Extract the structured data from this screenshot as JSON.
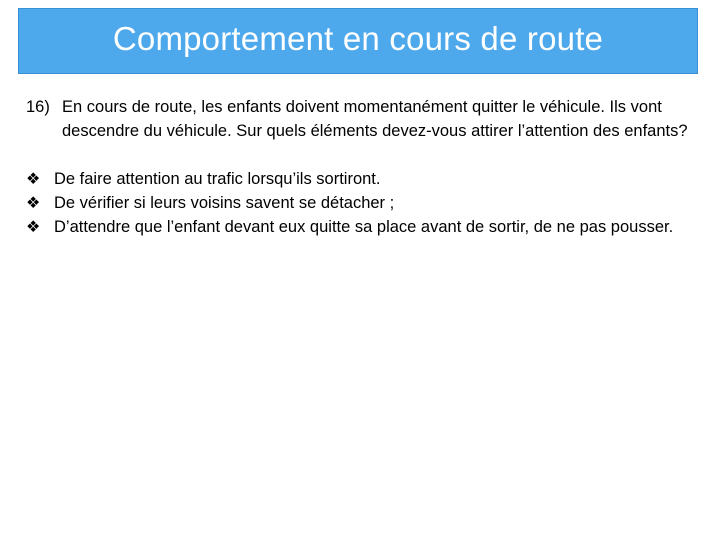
{
  "slide": {
    "title": "Comportement en cours de route",
    "accent_color": "#4ea8ec"
  },
  "question": {
    "number": "16)",
    "text": "En cours de route, les enfants doivent momentanément quitter le véhicule. Ils vont descendre du véhicule. Sur quels éléments devez-vous attirer l’attention des enfants?"
  },
  "bullets": {
    "icon": "diamond-bullet-icon",
    "items": [
      {
        "text": "De faire attention au trafic lorsqu’ils sortiront."
      },
      {
        "text": "De vérifier si leurs voisins savent se détacher ;"
      },
      {
        "text": "D’attendre que l’enfant devant eux quitte sa place avant de sortir, de ne pas pousser."
      }
    ]
  }
}
